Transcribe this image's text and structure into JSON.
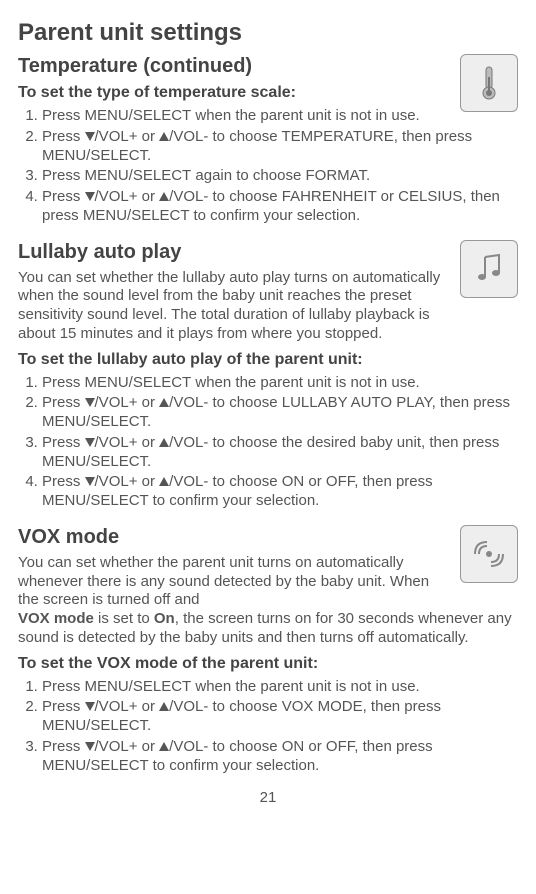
{
  "page_title": "Parent unit settings",
  "temperature": {
    "heading": "Temperature (continued)",
    "sub_heading": "To set the type of temperature scale:",
    "step1a": "Press ",
    "step1b": "MENU/",
    "step1c": "SELECT",
    "step1d": " when the parent unit is not in use.",
    "step2a": "Press ",
    "step2b": "/VOL+",
    "step2c": " or ",
    "step2d": "/VOL-",
    "step2e": " to choose ",
    "step2f": "TEMPERATURE",
    "step2g": ", then press ",
    "step2h": "MENU",
    "step2i": "/SELECT",
    "step2j": ".",
    "step3a": "Press ",
    "step3b": "MENU/",
    "step3c": "SELECT",
    "step3d": " again to choose ",
    "step3e": "FORMAT",
    "step3f": ".",
    "step4a": "Press ",
    "step4b": "/VOL+",
    "step4c": " or ",
    "step4d": "/VOL-",
    "step4e": " to choose ",
    "step4f": "FAHRENHEIT",
    "step4g": " or ",
    "step4h": "CELSIUS",
    "step4i": ", then press ",
    "step4j": "MENU",
    "step4k": "/SELECT",
    "step4l": " to confirm your selection."
  },
  "lullaby": {
    "heading": "Lullaby auto play",
    "desc": "You can set whether the lullaby auto play turns on automatically when the sound level from the baby unit reaches the preset sensitivity sound level. The total duration of lullaby playback is about 15 minutes and it plays from where you stopped.",
    "sub_heading": "To set the lullaby auto play of the parent unit:",
    "s1a": "Press ",
    "s1b": "MENU/",
    "s1c": "SELECT",
    "s1d": " when the parent unit is not in use.",
    "s2a": "Press ",
    "s2b": "/VOL+",
    "s2c": " or ",
    "s2d": "/VOL-",
    "s2e": " to choose ",
    "s2f": "LULLABY AUTO PLAY",
    "s2g": ", then press ",
    "s2h": "MENU",
    "s2i": "/SELECT",
    "s2j": ".",
    "s3a": "Press ",
    "s3b": "/VOL+",
    "s3c": " or ",
    "s3d": "/VOL-",
    "s3e": " to choose the desired baby unit, then press ",
    "s3f": "MENU",
    "s3g": "/SELECT",
    "s3h": ".",
    "s4a": "Press ",
    "s4b": "/VOL+",
    "s4c": " or ",
    "s4d": "/VOL-",
    "s4e": " to choose ",
    "s4f": "ON",
    "s4g": " or ",
    "s4h": "OFF",
    "s4i": ", then press ",
    "s4j": "MENU",
    "s4k": "/SELECT",
    "s4l": " to confirm your selection."
  },
  "vox": {
    "heading": "VOX mode",
    "desc_a": "You can set whether the parent unit turns on automatically whenever there is any sound detected by the baby unit. When the screen is turned off and ",
    "desc_b": "VOX mode",
    "desc_c": " is set to ",
    "desc_d": "On",
    "desc_e": ", the screen turns on for 30 seconds whenever any sound is detected by the baby units and then turns off automatically.",
    "sub_heading": "To set the VOX mode of the parent unit:",
    "s1a": "Press ",
    "s1b": "MENU/",
    "s1c": "SELECT",
    "s1d": " when the parent unit is not in use.",
    "s2a": "Press ",
    "s2b": "/VOL+",
    "s2c": " or ",
    "s2d": "/VOL-",
    "s2e": " to choose ",
    "s2f": "VOX MODE",
    "s2g": ", then press ",
    "s2h": "MENU",
    "s2i": "/SELECT",
    "s2j": ".",
    "s3a": "Press ",
    "s3b": "/VOL+",
    "s3c": " or ",
    "s3d": "/VOL-",
    "s3e": " to choose ",
    "s3f": "ON",
    "s3g": " or ",
    "s3h": "OFF",
    "s3i": ", then press ",
    "s3j": "MENU",
    "s3k": "/SELECT",
    "s3l": " to confirm your selection."
  },
  "page_number": "21"
}
